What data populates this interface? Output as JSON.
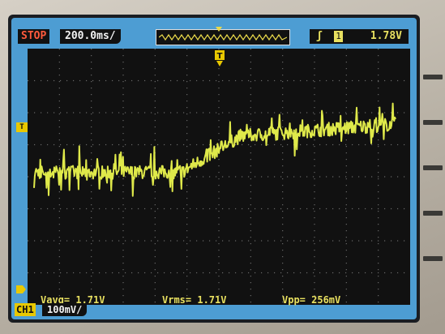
{
  "status": {
    "run_state": "STOP",
    "timebase": "200.0ms/"
  },
  "trigger": {
    "edge_icon": "rising-edge-icon",
    "source": "1",
    "level": "1.78V"
  },
  "markers": {
    "trigger_position": "T",
    "trigger_level": "T",
    "channel_ground": "ground-marker"
  },
  "measurements": {
    "vavg": "Vavg= 1.71V",
    "vrms": "Vrms= 1.71V",
    "vpp": "Vpp= 256mV"
  },
  "channel": {
    "label": "CH1",
    "scale": "100mV/"
  },
  "colors": {
    "screen": "#4d9dd3",
    "graticule": "#111111",
    "trace": "#dfe94a",
    "run_state": "#ff5a3c",
    "channel": "#e8c800"
  },
  "trace_data": {
    "description_units": "volts vs time",
    "x_unit": "s",
    "y_unit": "V",
    "segments": [
      {
        "t_start": 0.0,
        "t_end": 0.8,
        "level": 1.64
      },
      {
        "t_start": 0.8,
        "t_end": 1.12,
        "level_start": 1.64,
        "level_end": 1.76
      },
      {
        "t_start": 1.12,
        "t_end": 1.96,
        "level_start": 1.76,
        "level_end": 1.8
      }
    ],
    "noise_pp": 0.256
  }
}
